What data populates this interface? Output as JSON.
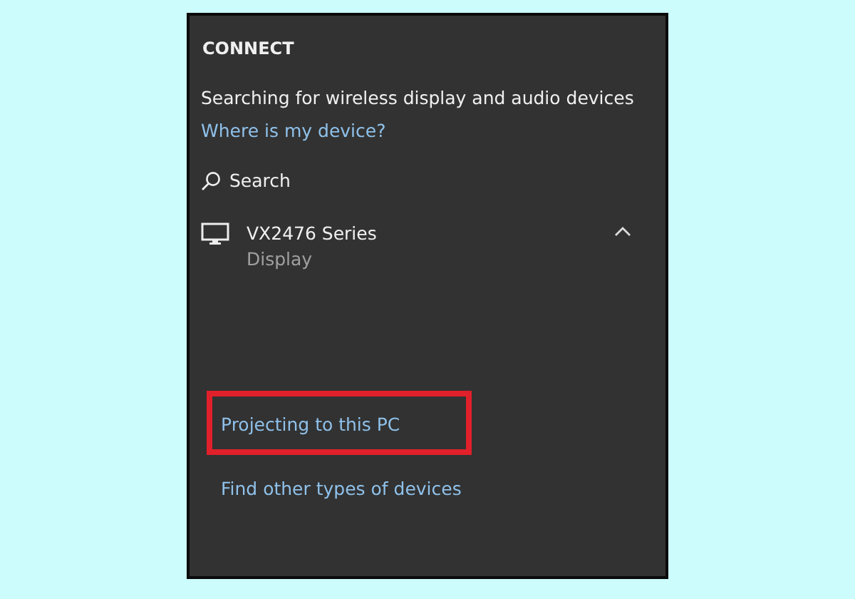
{
  "title": "CONNECT",
  "status": "Searching for wireless display and audio devices",
  "help_link": "Where is my device?",
  "search": {
    "label": "Search"
  },
  "devices": [
    {
      "name": "VX2476 Series",
      "type": "Display",
      "expanded": true
    }
  ],
  "links": [
    {
      "label": "Projecting to this PC",
      "highlighted": true
    },
    {
      "label": "Find other types of devices",
      "highlighted": false
    }
  ]
}
